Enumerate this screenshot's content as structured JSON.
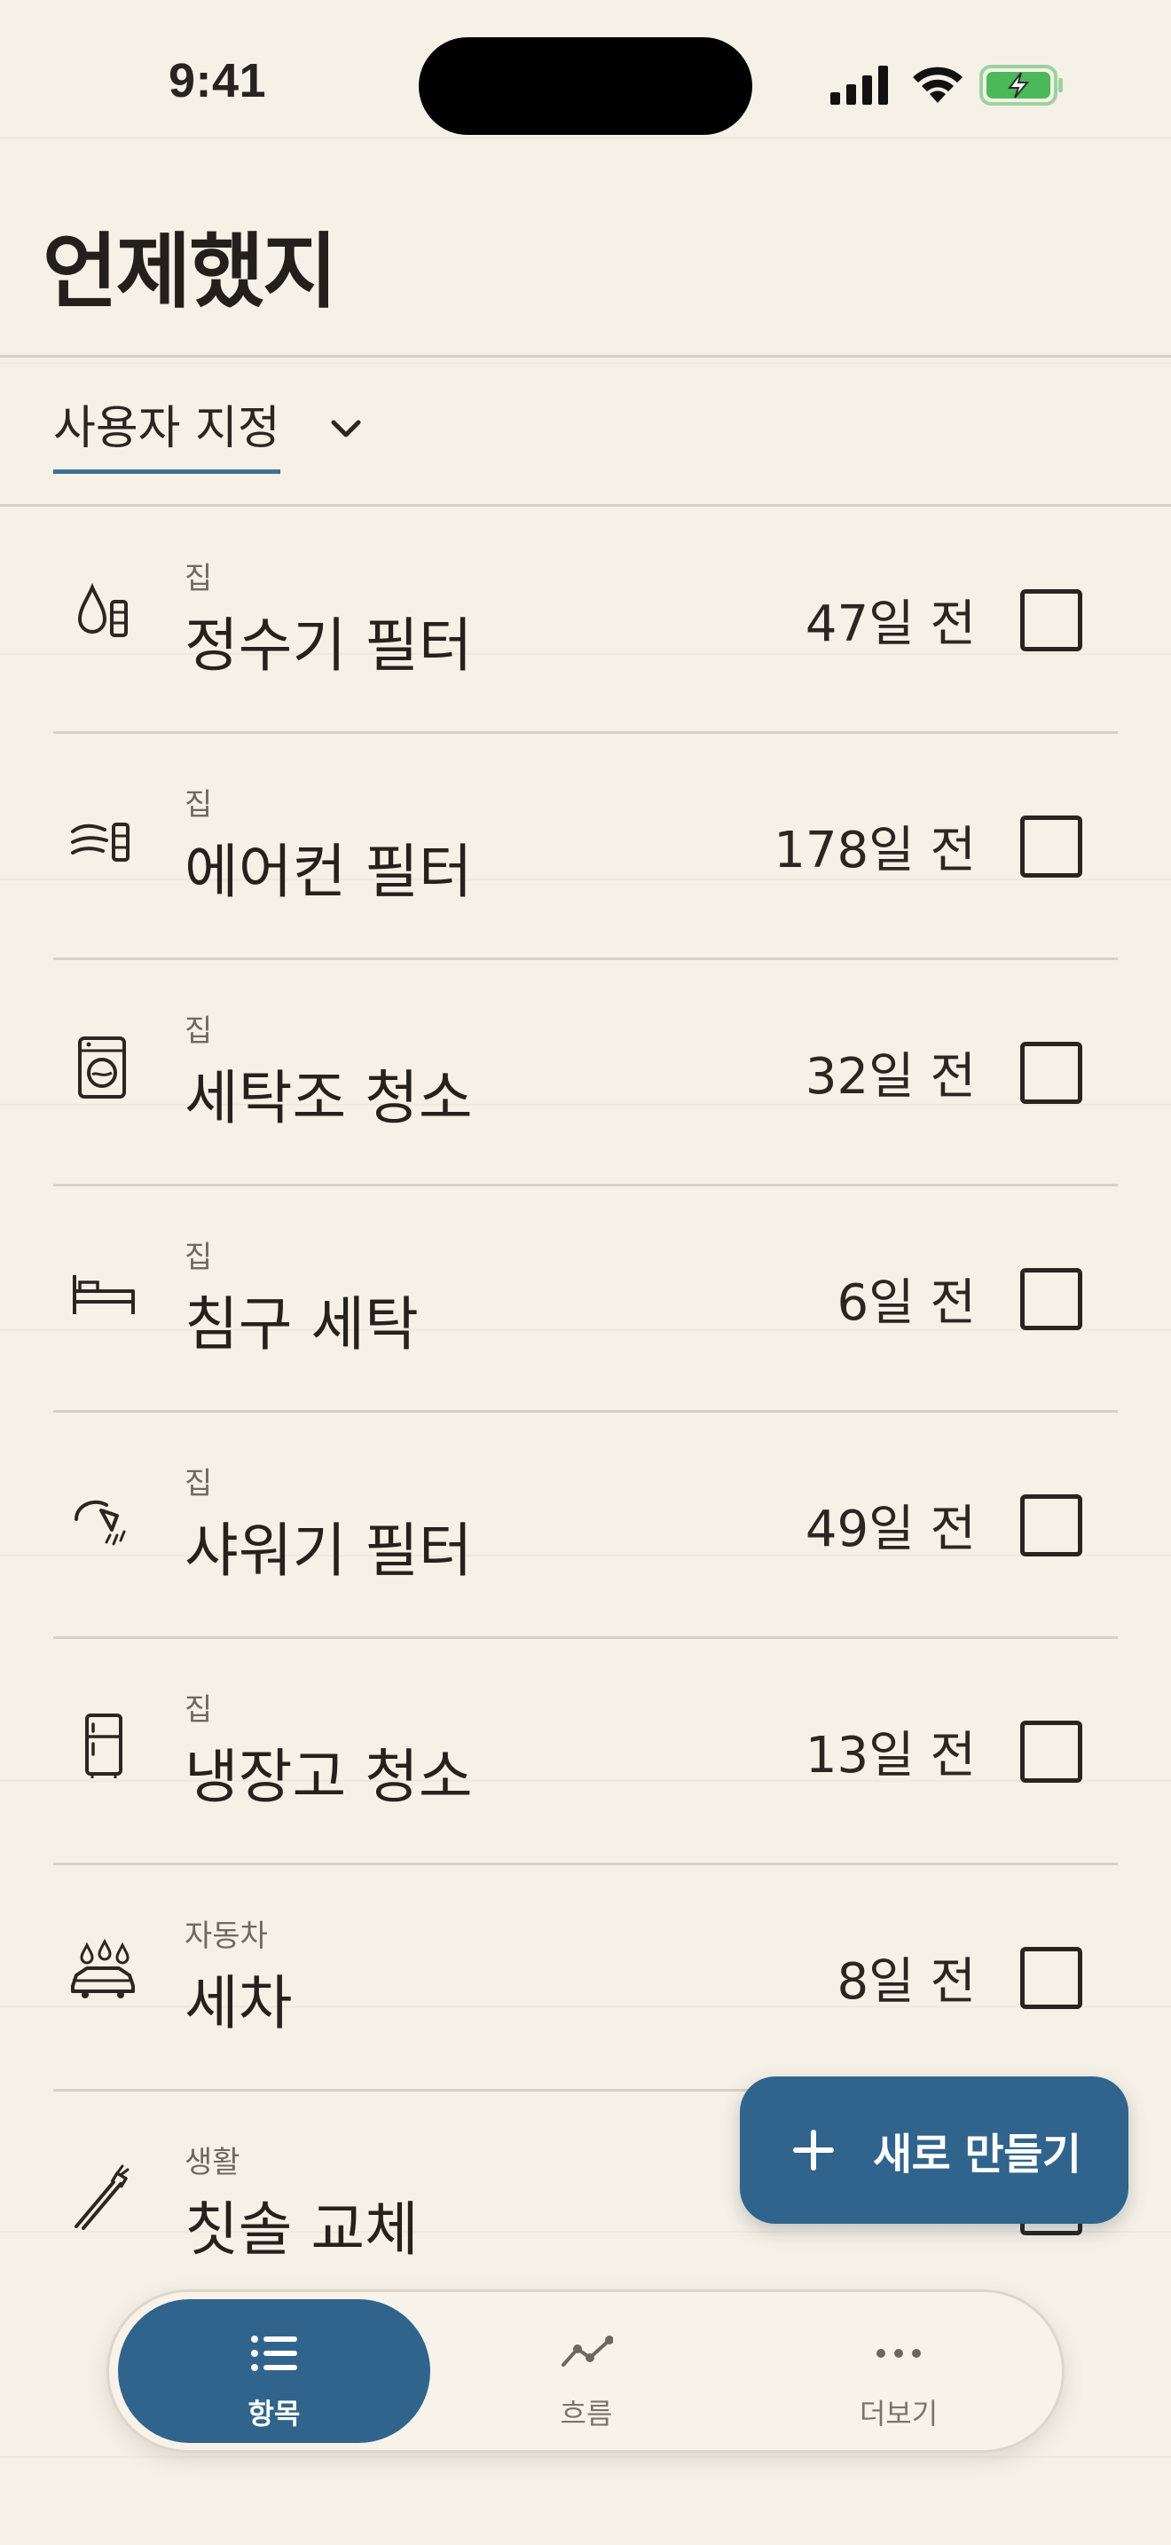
{
  "status_bar": {
    "time": "9:41",
    "icons": [
      "cellular-signal-icon",
      "wifi-icon",
      "battery-charging-icon"
    ],
    "battery_color": "#4bb85a"
  },
  "header": {
    "title": "언제했지"
  },
  "filter": {
    "label": "사용자 지정",
    "accent": "#3f7096"
  },
  "items": [
    {
      "category": "집",
      "name": "정수기 필터",
      "days": "47일 전",
      "icon": "water-filter-icon"
    },
    {
      "category": "집",
      "name": "에어컨 필터",
      "days": "178일 전",
      "icon": "air-conditioner-icon"
    },
    {
      "category": "집",
      "name": "세탁조 청소",
      "days": "32일 전",
      "icon": "washing-machine-icon"
    },
    {
      "category": "집",
      "name": "침구 세탁",
      "days": "6일 전",
      "icon": "bed-icon"
    },
    {
      "category": "집",
      "name": "샤워기 필터",
      "days": "49일 전",
      "icon": "shower-head-icon"
    },
    {
      "category": "집",
      "name": "냉장고 청소",
      "days": "13일 전",
      "icon": "refrigerator-icon"
    },
    {
      "category": "자동차",
      "name": "세차",
      "days": "8일 전",
      "icon": "car-wash-icon"
    },
    {
      "category": "생활",
      "name": "칫솔 교체",
      "days": "",
      "icon": "toothbrush-icon"
    }
  ],
  "fab": {
    "label": "새로 만들기",
    "color": "#30648c"
  },
  "tabbar": {
    "tabs": [
      {
        "label": "항목",
        "icon": "list-icon",
        "active": true
      },
      {
        "label": "흐름",
        "icon": "trend-line-icon",
        "active": false
      },
      {
        "label": "더보기",
        "icon": "more-dots-icon",
        "active": false
      }
    ]
  }
}
